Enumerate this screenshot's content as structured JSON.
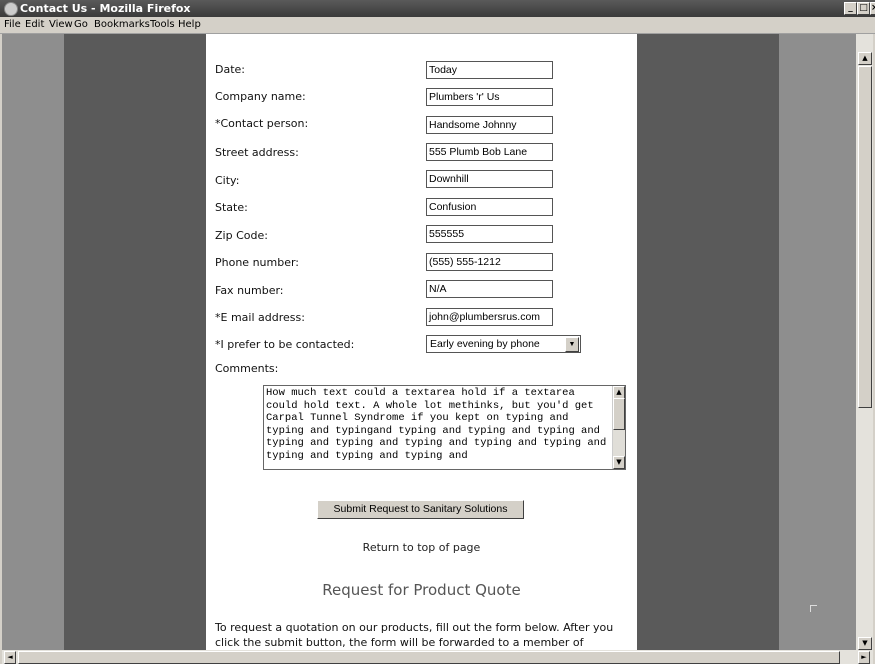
{
  "window": {
    "title": "Contact Us - Mozilla Firefox"
  },
  "menu": [
    "File",
    "Edit",
    "View",
    "Go",
    "Bookmarks",
    "Tools",
    "Help"
  ],
  "form": {
    "date_label": "Date:",
    "date_value": "Today",
    "company_label": "Company name:",
    "company_value": "Plumbers 'r' Us",
    "contact_label": "Contact person:",
    "contact_value": "Handsome Johnny",
    "street_label": "Street address:",
    "street_value": "555 Plumb Bob Lane",
    "city_label": "City:",
    "city_value": "Downhill",
    "state_label": "State:",
    "state_value": "Confusion",
    "zip_label": "Zip Code:",
    "zip_value": "555555",
    "phone_label": "Phone number:",
    "phone_value": "(555) 555-1212",
    "fax_label": "Fax number:",
    "fax_value": "N/A",
    "email_label": "E mail address:",
    "email_value": "john@plumbersrus.com",
    "contact_pref_label": "I prefer to be contacted:",
    "contact_pref_value": "Early evening by phone",
    "required_marker": "*",
    "comments_label": "Comments:",
    "comments_value": "How much text could a textarea hold if a textarea could hold text. A whole lot methinks, but you'd get  Carpal Tunnel Syndrome if you kept on typing and typing and typingand typing and typing and typing and typing and typing and typing and typing and typing and typing and typing and typing and",
    "submit_label": "Submit Request to Sanitary Solutions"
  },
  "links": {
    "return_top": "Return to top of page"
  },
  "quote_section": {
    "heading": "Request for Product Quote",
    "intro": "To request a quotation on our products, fill out the form below. After you click the submit button, the form will be forwarded to a member of"
  }
}
